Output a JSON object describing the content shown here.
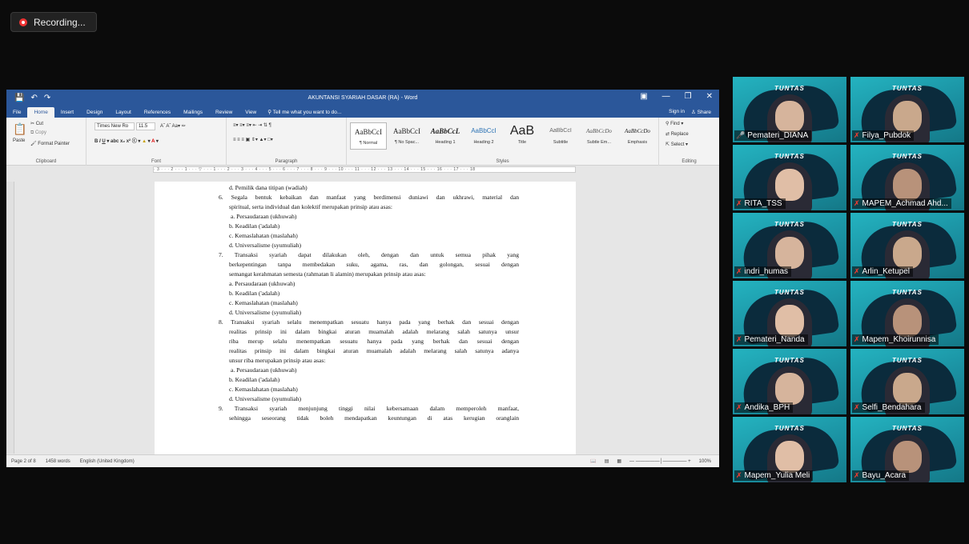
{
  "recording": {
    "label": "Recording..."
  },
  "word": {
    "title": "AKUNTANSI SYARIAH DASAR (RA) - Word",
    "tabs": [
      "File",
      "Home",
      "Insert",
      "Design",
      "Layout",
      "References",
      "Mailings",
      "Review",
      "View"
    ],
    "tell_me": "Tell me what you want to do...",
    "sign_in": "Sign in",
    "share": "Share",
    "clipboard": {
      "paste": "Paste",
      "cut": "Cut",
      "copy": "Copy",
      "format_painter": "Format Painter",
      "label": "Clipboard"
    },
    "font": {
      "name": "Times New Ro",
      "size": "11.5",
      "label": "Font"
    },
    "paragraph": {
      "label": "Paragraph"
    },
    "styles": {
      "label": "Styles",
      "items": [
        {
          "preview": "AaBbCcI",
          "name": "¶ Normal"
        },
        {
          "preview": "AaBbCcI",
          "name": "¶ No Spac..."
        },
        {
          "preview": "AaBbCcL",
          "name": "Heading 1"
        },
        {
          "preview": "AaBbCcI",
          "name": "Heading 2"
        },
        {
          "preview": "AaB",
          "name": "Title"
        },
        {
          "preview": "AaBbCcI",
          "name": "Subtitle"
        },
        {
          "preview": "AaBbCcDo",
          "name": "Subtle Em..."
        },
        {
          "preview": "AaBbCcDo",
          "name": "Emphasis"
        }
      ]
    },
    "editing": {
      "find": "Find",
      "replace": "Replace",
      "select": "Select",
      "label": "Editing"
    },
    "document_lines": [
      "d.  Pemilik dana titipan (wadiah)",
      "6.  Segala bentuk kebaikan dan manfaat yang berdimensi duniawi dan ukhrawi, material dan",
      "spiritual, serta individual dan kolektif merupakan prinsip atau asas:",
      "a. Persaudaraan (ukhuwah)",
      "b.  Keadilan ('adalah)",
      "c.  Kemaslahatan (maslahah)",
      "d.  Universalisme (syumuliah)",
      "7.  Transaksi syariah dapat dilakukan oleh, dengan dan untuk semua pihak yang",
      "berkepentingan tanpa membedakan suku, agama, ras, dan golongan, sesuai dengan",
      "semangat kerahmatan semesta (rahmatan li alamin) merupakan prinsip atau asas:",
      "a. Persaudaraan (ukhuwah)",
      "b.  Keadilan ('adalah)",
      "c.  Kemaslahatan (maslahah)",
      "d.  Universalisme (syumuliah)",
      "8.  Transaksi syariah selalu menempatkan sesuatu hanya pada yang berhak dan sesuai dengan",
      "realitas prinsip ini dalam bingkai aturan muamalah adalah melarang salah satunya unsur",
      "riba merup selalu menempatkan sesuatu hanya pada yang berhak dan sesuai dengan",
      "realitas prinsip ini dalam bingkai aturan muamalah adalah melarang salah satunya adanya",
      "unsur riba merupakan prinsip atau asas:",
      "a. Persaudaraan (ukhuwah)",
      "b.  Keadilan ('adalah)",
      "c.  Kemaslahatan (maslahah)",
      "d.  Universalisme (syumuliah)",
      "9.  Transaksi syariah menjunjung tinggi nilai kebersamaan dalam memperoleh manfaat,",
      "sehingga seseorang tidak boleh mendapatkan keuntungan di atas kerugian oranglain"
    ],
    "status": {
      "page": "Page 2 of 8",
      "words": "1458 words",
      "language": "English (United Kingdom)",
      "zoom": "100%"
    }
  },
  "participants": [
    {
      "name": "Pemateri_DIANA",
      "active": true,
      "muted": false
    },
    {
      "name": "Filya_Pubdok",
      "active": false,
      "muted": true
    },
    {
      "name": "RITA_TSS",
      "active": false,
      "muted": true
    },
    {
      "name": "MAPEM_Achmad Ahd...",
      "active": false,
      "muted": true
    },
    {
      "name": "indri_humas",
      "active": false,
      "muted": true
    },
    {
      "name": "Arlin_Ketupel",
      "active": false,
      "muted": true
    },
    {
      "name": "Pemateri_Nanda",
      "active": false,
      "muted": true
    },
    {
      "name": "Mapem_Khoirunnisa",
      "active": false,
      "muted": true
    },
    {
      "name": "Andika_BPH",
      "active": false,
      "muted": true
    },
    {
      "name": "Selfi_Bendahara",
      "active": false,
      "muted": true
    },
    {
      "name": "Mapem_Yulia Meli",
      "active": false,
      "muted": true
    },
    {
      "name": "Bayu_Acara",
      "active": false,
      "muted": true
    }
  ],
  "tile_banner": "TUNTAS",
  "colors": {
    "word_blue": "#2b579a",
    "active_speaker": "#c6e14a",
    "muted": "#ff3b30"
  }
}
